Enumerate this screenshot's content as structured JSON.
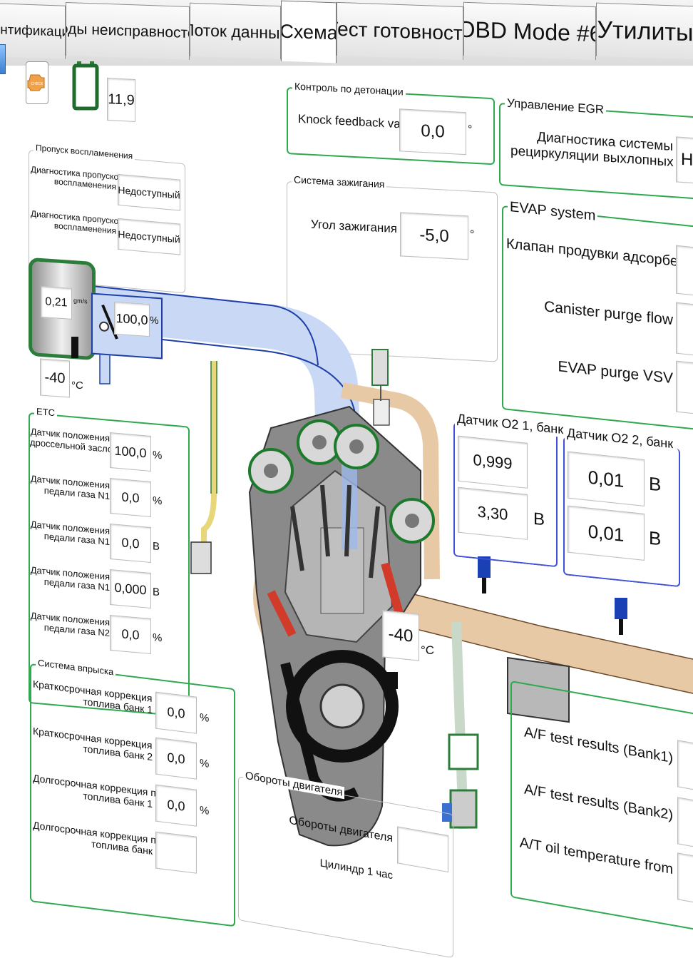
{
  "tabs": [
    {
      "label": "дентификация"
    },
    {
      "label": "Коды неисправностей"
    },
    {
      "label": "Поток данных"
    },
    {
      "label": "Схема"
    },
    {
      "label": "Тест готовности"
    },
    {
      "label": "OBD Mode #6"
    },
    {
      "label": "Утилиты"
    }
  ],
  "battery": {
    "value": "11,9"
  },
  "misfire": {
    "title": "Пропуск воспламенения",
    "rows": [
      {
        "label1": "Диагностика пропусков",
        "label2": "воспламенения",
        "value": "Недоступный"
      },
      {
        "label1": "Диагностика пропусков",
        "label2": "воспламенения",
        "value": "Недоступный"
      }
    ]
  },
  "knock": {
    "title": "Контроль по детонации",
    "label": "Knock feedback value",
    "value": "0,0",
    "unit": "°"
  },
  "ignition": {
    "title": "Система зажигания",
    "label": "Угол зажигания",
    "value": "-5,0",
    "unit": "°"
  },
  "egr": {
    "title": "Управление EGR",
    "label1": "Диагностика системы",
    "label2": "рециркуляции выхлопных",
    "value": "Не"
  },
  "evap": {
    "title": "EVAP system",
    "rows": [
      {
        "label": "Клапан продувки адсорбера"
      },
      {
        "label": "Canister purge flow"
      },
      {
        "label": "EVAP purge VSV"
      }
    ]
  },
  "maf": {
    "value": "0,21",
    "unit": "gm/s"
  },
  "throttle_plate": {
    "value": "100,0",
    "unit": "%"
  },
  "intake_temp": {
    "value": "-40",
    "unit": "°C"
  },
  "etc": {
    "title": "ETC",
    "rows": [
      {
        "label1": "Датчик положения",
        "label2": "дроссельной заслонки",
        "value": "100,0",
        "unit": "%"
      },
      {
        "label1": "Датчик положения",
        "label2": "педали газа N1",
        "value": "0,0",
        "unit": "%"
      },
      {
        "label1": "Датчик положения",
        "label2": "педали газа N1",
        "value": "0,0",
        "unit": "В"
      },
      {
        "label1": "Датчик положения",
        "label2": "педали газа N1",
        "value": "0,000",
        "unit": "В"
      },
      {
        "label1": "Датчик положения",
        "label2": "педали газа N2",
        "value": "0,0",
        "unit": "%"
      }
    ]
  },
  "injection": {
    "title": "Система впрыска",
    "rows": [
      {
        "label1": "Краткосрочная коррекция подачи",
        "label2": "топлива банк 1",
        "value": "0,0",
        "unit": "%"
      },
      {
        "label1": "Краткосрочная коррекция подачи",
        "label2": "топлива банк 2",
        "value": "0,0",
        "unit": "%"
      },
      {
        "label1": "Долгосрочная коррекция подачи",
        "label2": "топлива банк 1",
        "value": "0,0",
        "unit": "%"
      },
      {
        "label1": "Долгосрочная коррекция подачи",
        "label2": "топлива банк",
        "value": "",
        "unit": ""
      }
    ]
  },
  "rpm": {
    "title": "Обороты двигателя",
    "label": "Обороты двигателя",
    "label2": "Цилиндр 1 час"
  },
  "coolant": {
    "value": "-40",
    "unit": "°C"
  },
  "o2_bank1": {
    "title": "Датчик O2 1, банк",
    "value1": "0,999",
    "value2": "3,30",
    "unit": "В"
  },
  "o2_bank2": {
    "title": "Датчик O2 2, банк",
    "value1": "0,01",
    "unit1": "В",
    "value2": "0,01",
    "unit2": "В"
  },
  "af": {
    "rows": [
      {
        "label": "A/F test results (Bank1)"
      },
      {
        "label": "A/F test results (Bank2)"
      },
      {
        "label": "A/T oil temperature from"
      }
    ]
  },
  "colors": {
    "group_border": "#2fa84f",
    "intake_pipe": "#c9d9f5",
    "exhaust_pipe": "#e8c9a6",
    "o2_border": "#3f51d8"
  }
}
